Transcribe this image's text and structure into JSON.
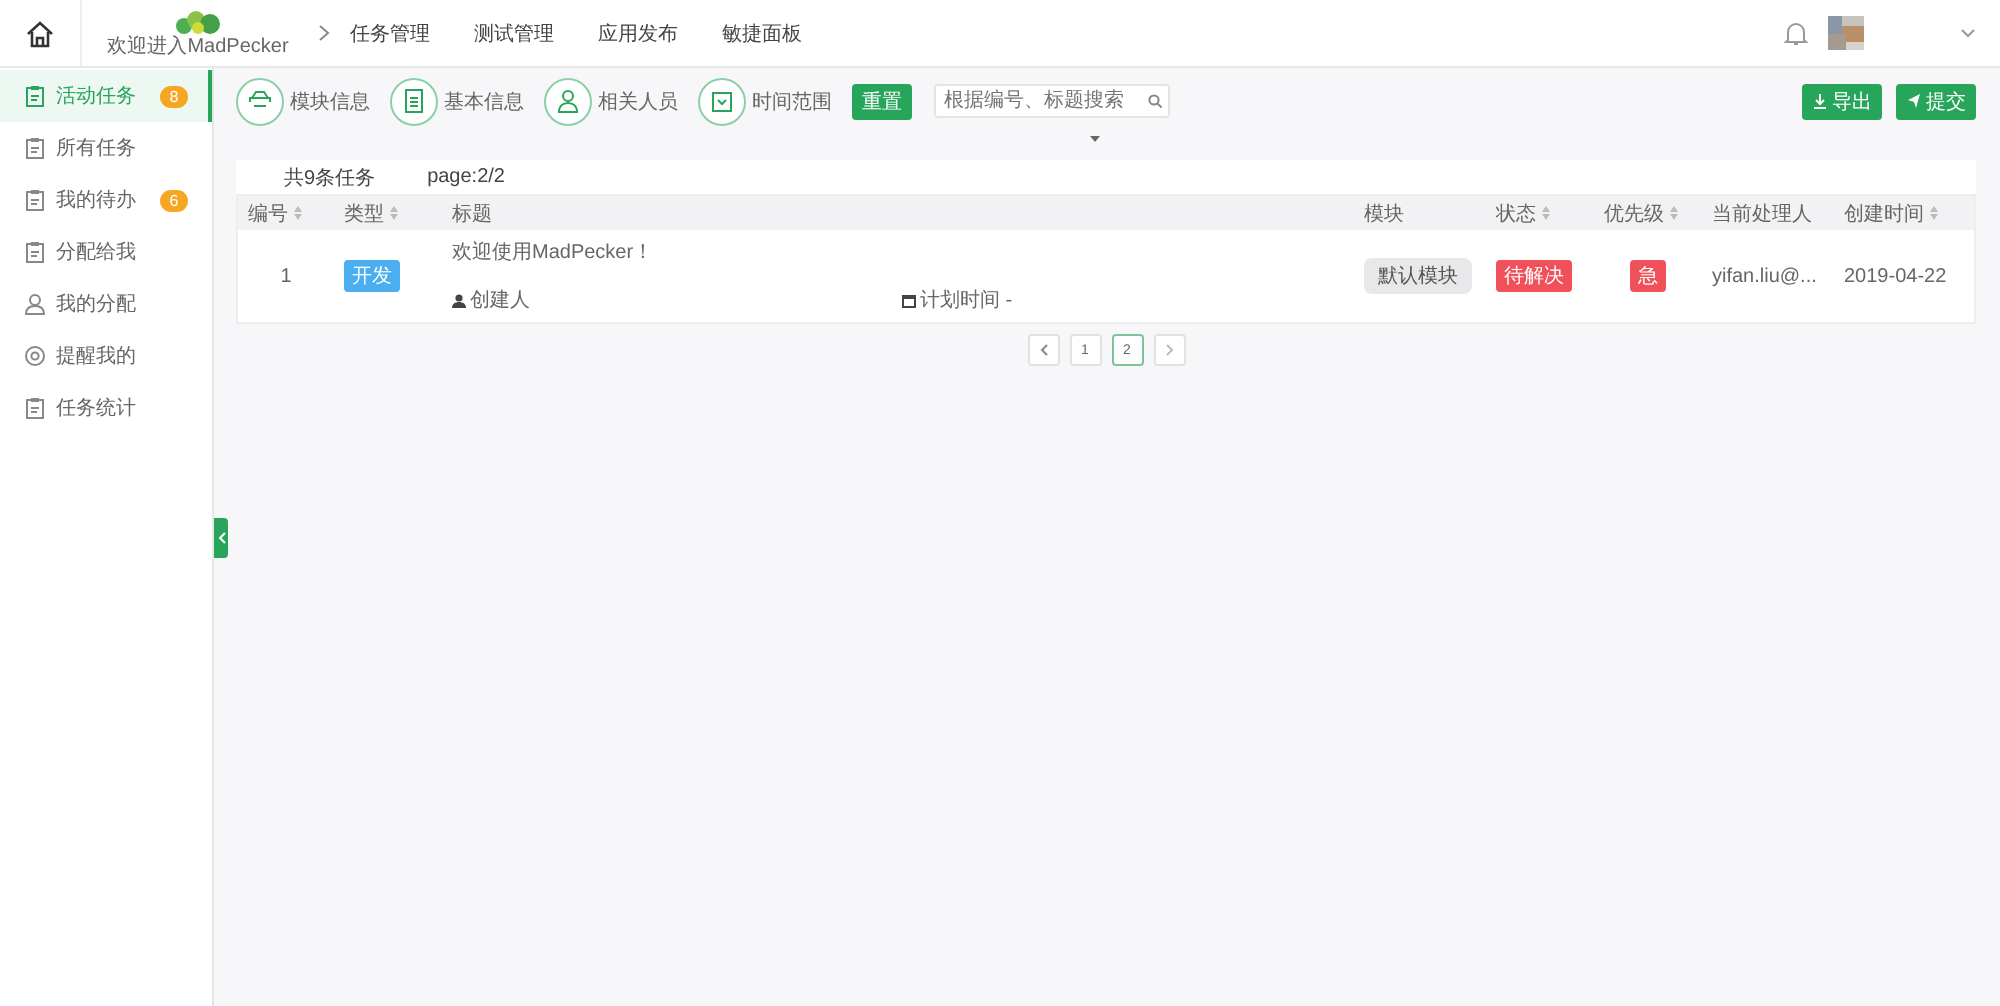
{
  "header": {
    "logo_caption": "欢迎进入MadPecker",
    "nav": [
      {
        "label": "任务管理"
      },
      {
        "label": "测试管理"
      },
      {
        "label": "应用发布"
      },
      {
        "label": "敏捷面板"
      }
    ]
  },
  "sidebar": {
    "items": [
      {
        "label": "活动任务",
        "kind": "clipboard",
        "badge": "8",
        "selected": true
      },
      {
        "label": "所有任务",
        "kind": "clipboard",
        "selected": false
      },
      {
        "label": "我的待办",
        "kind": "clipboard",
        "badge": "6",
        "selected": false
      },
      {
        "label": "分配给我",
        "kind": "clipboard",
        "selected": false
      },
      {
        "label": "我的分配",
        "kind": "person",
        "selected": false
      },
      {
        "label": "提醒我的",
        "kind": "mention",
        "selected": false
      },
      {
        "label": "任务统计",
        "kind": "clipboard",
        "selected": false
      }
    ]
  },
  "filters": [
    {
      "label": "模块信息",
      "kind": "module"
    },
    {
      "label": "基本信息",
      "kind": "document"
    },
    {
      "label": "相关人员",
      "kind": "person"
    },
    {
      "label": "时间范围",
      "kind": "calendar"
    }
  ],
  "reset_button": "重置",
  "search": {
    "placeholder": "根据编号、标题搜索"
  },
  "actions": [
    {
      "label": "导出",
      "kind": "download"
    },
    {
      "label": "提交",
      "kind": "send"
    }
  ],
  "summary": {
    "count": "共9条任务",
    "page": "page:2/2"
  },
  "table": {
    "columns": [
      {
        "label": "编号",
        "sortable": true
      },
      {
        "label": "类型",
        "sortable": true
      },
      {
        "label": "标题",
        "sortable": false
      },
      {
        "label": "模块",
        "sortable": false
      },
      {
        "label": "状态",
        "sortable": true
      },
      {
        "label": "优先级",
        "sortable": true
      },
      {
        "label": "当前处理人",
        "sortable": false
      },
      {
        "label": "创建时间",
        "sortable": true
      }
    ],
    "rows": [
      {
        "id": "1",
        "type": "开发",
        "title": "欢迎使用MadPecker！",
        "creator_label": "创建人",
        "plan_label": "计划时间 -",
        "module": "默认模块",
        "status": "待解决",
        "priority": "急",
        "assignee": "yifan.liu@...",
        "created": "2019-04-22"
      }
    ]
  },
  "pagination": {
    "pages": [
      {
        "label": "1",
        "selected": false
      },
      {
        "label": "2",
        "selected": true
      }
    ]
  }
}
